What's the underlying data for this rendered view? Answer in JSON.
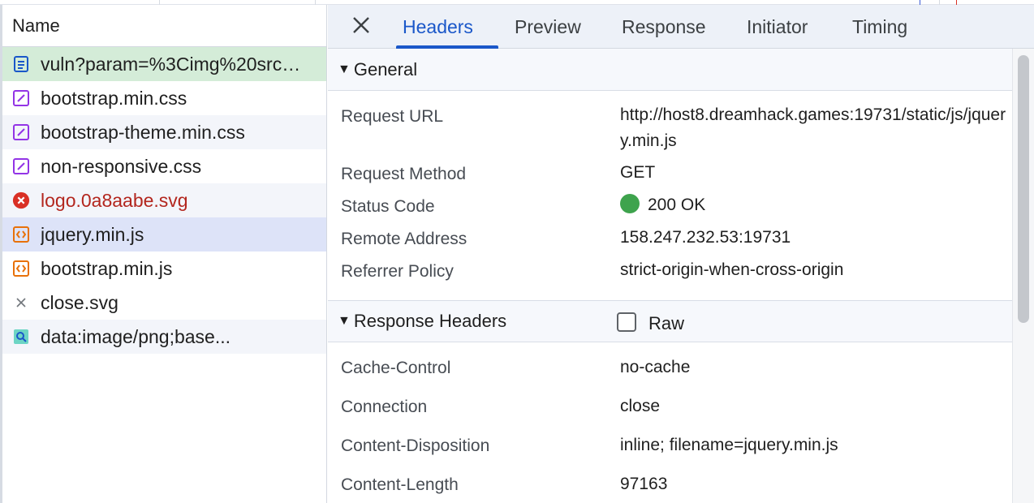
{
  "left_panel": {
    "header": "Name",
    "requests": [
      {
        "name": "vuln?param=%3Cimg%20src%3D...",
        "icon": "document-icon",
        "state": "selected-doc"
      },
      {
        "name": "bootstrap.min.css",
        "icon": "stylesheet-icon",
        "state": "normal"
      },
      {
        "name": "bootstrap-theme.min.css",
        "icon": "stylesheet-icon",
        "state": "alt"
      },
      {
        "name": "non-responsive.css",
        "icon": "stylesheet-icon",
        "state": "normal"
      },
      {
        "name": "logo.0a8aabe.svg",
        "icon": "error-icon",
        "state": "error"
      },
      {
        "name": "jquery.min.js",
        "icon": "script-icon",
        "state": "active"
      },
      {
        "name": "bootstrap.min.js",
        "icon": "script-icon",
        "state": "normal"
      },
      {
        "name": "close.svg",
        "icon": "close-small-icon",
        "state": "normal"
      },
      {
        "name": "data:image/png;base...",
        "icon": "image-icon",
        "state": "alt"
      }
    ]
  },
  "tabs": {
    "items": [
      "Headers",
      "Preview",
      "Response",
      "Initiator",
      "Timing"
    ],
    "active": "Headers"
  },
  "general": {
    "title": "General",
    "request_url_label": "Request URL",
    "request_url_value": "http://host8.dreamhack.games:19731/static/js/jquery.min.js",
    "request_method_label": "Request Method",
    "request_method_value": "GET",
    "status_code_label": "Status Code",
    "status_code_value": "200 OK",
    "remote_address_label": "Remote Address",
    "remote_address_value": "158.247.232.53:19731",
    "referrer_policy_label": "Referrer Policy",
    "referrer_policy_value": "strict-origin-when-cross-origin"
  },
  "response_headers": {
    "title": "Response Headers",
    "raw_label": "Raw",
    "rows": [
      {
        "key": "Cache-Control",
        "value": "no-cache"
      },
      {
        "key": "Connection",
        "value": "close"
      },
      {
        "key": "Content-Disposition",
        "value": "inline; filename=jquery.min.js"
      },
      {
        "key": "Content-Length",
        "value": "97163"
      }
    ]
  },
  "colors": {
    "accent": "#1a57c9",
    "status_ok": "#3ea34d",
    "error_text": "#b3261e",
    "selected_doc_bg": "#d4ecd8",
    "active_row_bg": "#dde3f8"
  }
}
